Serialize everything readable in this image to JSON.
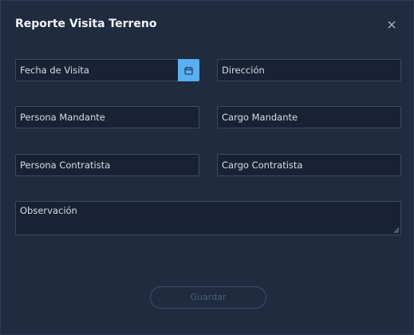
{
  "dialog": {
    "title": "Reporte Visita Terreno",
    "close_icon": "close-icon"
  },
  "form": {
    "fecha_visita": {
      "placeholder": "Fecha de Visita",
      "value": ""
    },
    "calendar_icon": "calendar-icon",
    "direccion": {
      "placeholder": "Dirección",
      "value": ""
    },
    "persona_mandante": {
      "placeholder": "Persona Mandante",
      "value": ""
    },
    "cargo_mandante": {
      "placeholder": "Cargo Mandante",
      "value": ""
    },
    "persona_contratista": {
      "placeholder": "Persona Contratista",
      "value": ""
    },
    "cargo_contratista": {
      "placeholder": "Cargo Contratista",
      "value": ""
    },
    "observacion": {
      "placeholder": "Observación",
      "value": ""
    }
  },
  "actions": {
    "save_label": "Guardar"
  },
  "colors": {
    "background": "#1f2c40",
    "input_background": "#182234",
    "input_border": "#3a4a60",
    "accent": "#5aaef2",
    "disabled_button_text": "#4b5e79"
  }
}
